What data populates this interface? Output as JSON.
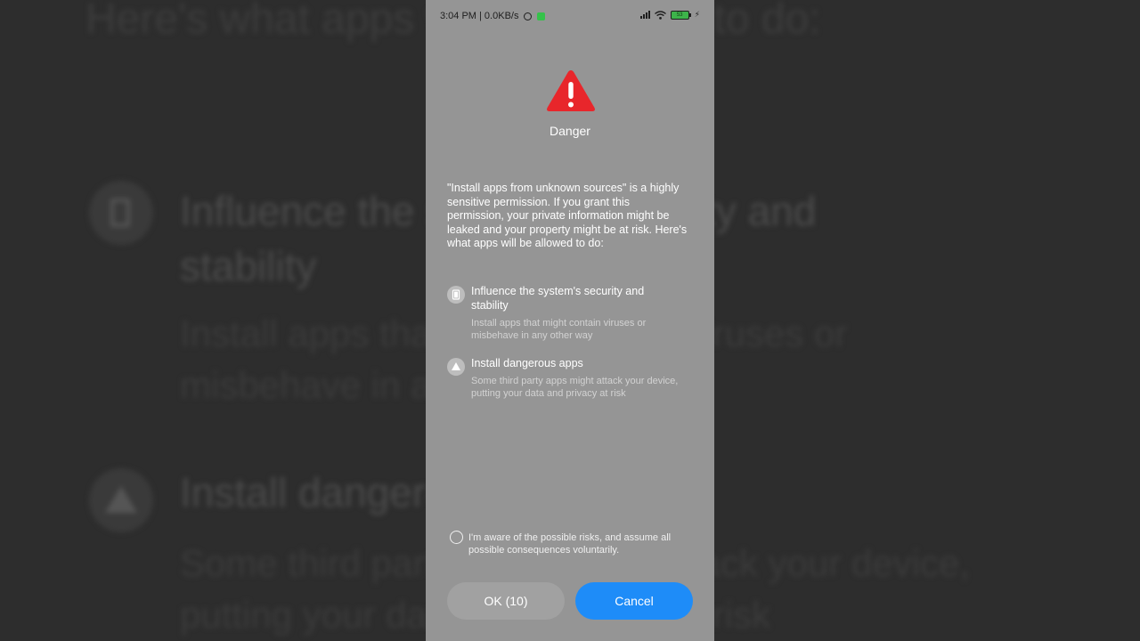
{
  "statusbar": {
    "time_speed": "3:04 PM | 0.0KB/s",
    "battery": "53",
    "icons": [
      "alarm-icon",
      "notification-icon",
      "signal-icon",
      "wifi-icon",
      "battery-icon",
      "charging-icon"
    ]
  },
  "dialog": {
    "title": "Danger",
    "icon": "warning-triangle-icon",
    "intro": "\"Install apps from unknown sources\" is a highly sensitive permission. If you grant this permission, your private information might be leaked and your property might be at risk. Here's what apps will be allowed to do:",
    "permissions": [
      {
        "icon": "phone-security-icon",
        "title": "Influence the system's security and stability",
        "description": "Install apps that might contain viruses or misbehave in any other way"
      },
      {
        "icon": "warning-icon",
        "title": "Install dangerous apps",
        "description": "Some third party apps might attack your device, putting your data and privacy at risk"
      }
    ],
    "aware_text": "I'm aware of the possible risks, and assume all possible consequences voluntarily.",
    "ok_label": "OK (10)",
    "cancel_label": "Cancel"
  },
  "background": {
    "top": "Here's what apps will be allowed to do:",
    "title1": "Influence the system's security and stability",
    "sub1": "Install apps that might contain viruses or misbehave in any other way",
    "title2": "Install dangerous apps",
    "sub2": "Some third party apps might attack your device, putting your data and privacy at risk"
  },
  "colors": {
    "accent": "#1E8CF8",
    "danger": "#E8262B",
    "dialog_bg": "#959595"
  }
}
